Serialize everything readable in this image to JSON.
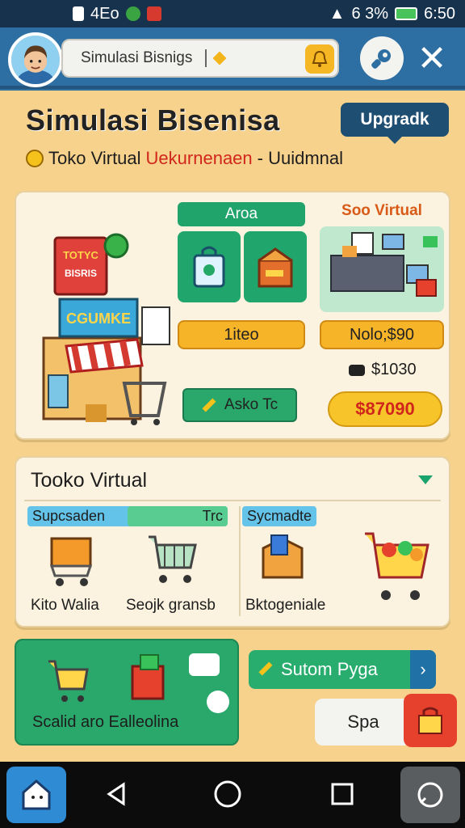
{
  "status_bar": {
    "left_text": "4Eo",
    "right_text": "6 3%",
    "time": "6:50"
  },
  "header": {
    "search_text": "Simulasi Bisnigs",
    "search_icon": "bell-icon",
    "gear_icon": "wrench-icon",
    "close_icon": "close-icon"
  },
  "main": {
    "title": "Simulasi Bisenisa",
    "upgrade_label": "Upgradk",
    "subtitle_prefix": "Toko Virtual",
    "subtitle_highlight": "Uekurnenaen",
    "subtitle_suffix": "- Uuidmnal"
  },
  "panel1": {
    "shop_sign_top": "TOTYC BISRIS",
    "shop_sign_bottom": "CGUMKE",
    "column_a_label": "Aroa",
    "column_b_label": "Soo Virtual",
    "item_button": "1iteo",
    "value_button": "Nolo;$90",
    "stock_text": "$1030",
    "asko_button": "Asko Tc",
    "price_button": "$87090"
  },
  "panel2": {
    "title": "Tooko Virtual",
    "tag_left": "Supcsaden",
    "tag_left_right": "Trc",
    "tag_right": "Sycmadte",
    "item1_label": "Kito Walia",
    "item2_label": "Seojk gransb",
    "item3_label": "Bktogeniale"
  },
  "panel3": {
    "label": "Scalid aro Ealleolina"
  },
  "actions": {
    "custom_button": "Sutom Pyga",
    "spa_button": "Spa"
  },
  "colors": {
    "header_blue": "#2e6fa3",
    "board_sand": "#f7d28d",
    "accent_green": "#21a36c",
    "accent_yellow": "#f6b428",
    "price_red": "#d1261c"
  }
}
